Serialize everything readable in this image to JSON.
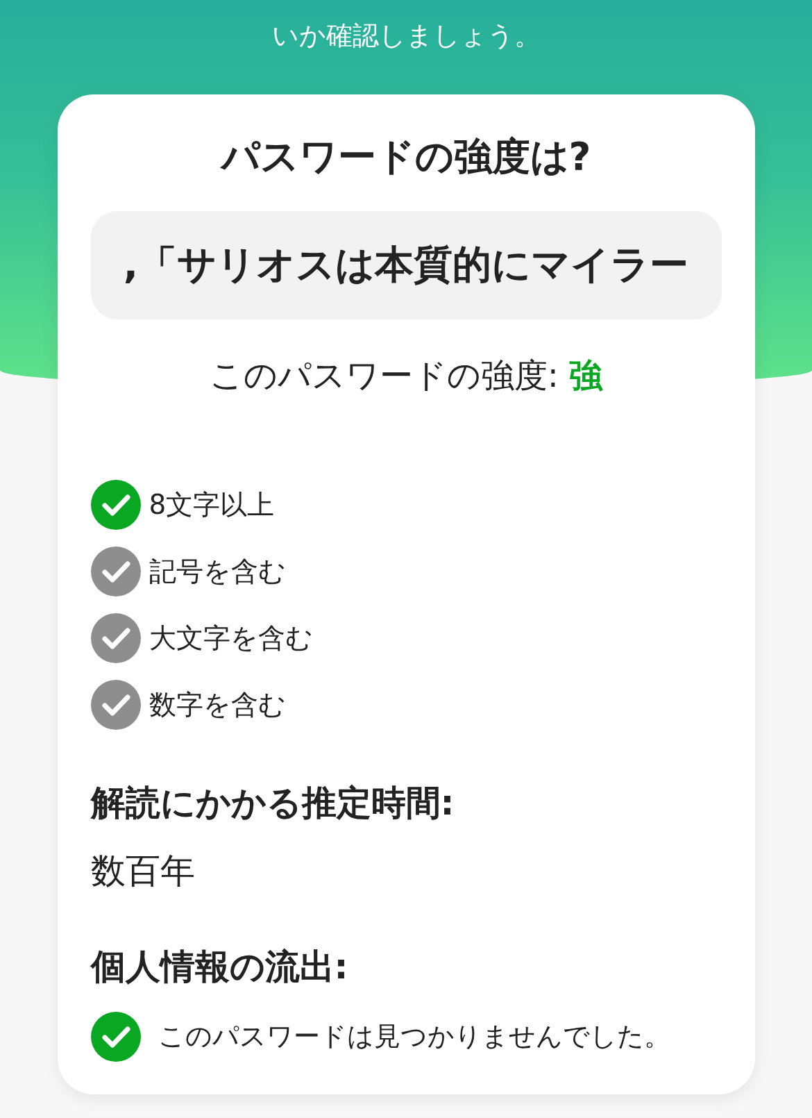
{
  "intro": {
    "text": "いか確認しましょう。"
  },
  "card": {
    "title": "パスワードの強度は?",
    "password_field": {
      "value": ",「サリオスは本質的にマイラー"
    },
    "strength": {
      "label": "このパスワードの強度:",
      "value": "強",
      "kind": "strong"
    },
    "checks": [
      {
        "label": "8文字以上",
        "checked": true
      },
      {
        "label": "記号を含む",
        "checked": false
      },
      {
        "label": "大文字を含む",
        "checked": false
      },
      {
        "label": "数字を含む",
        "checked": false
      }
    ],
    "crack_time": {
      "heading": "解読にかかる推定時間:",
      "value": "数百年"
    },
    "leak": {
      "heading": "個人情報の流出:",
      "result": {
        "text": "このパスワードは見つかりませんでした。",
        "safe": true
      }
    }
  }
}
